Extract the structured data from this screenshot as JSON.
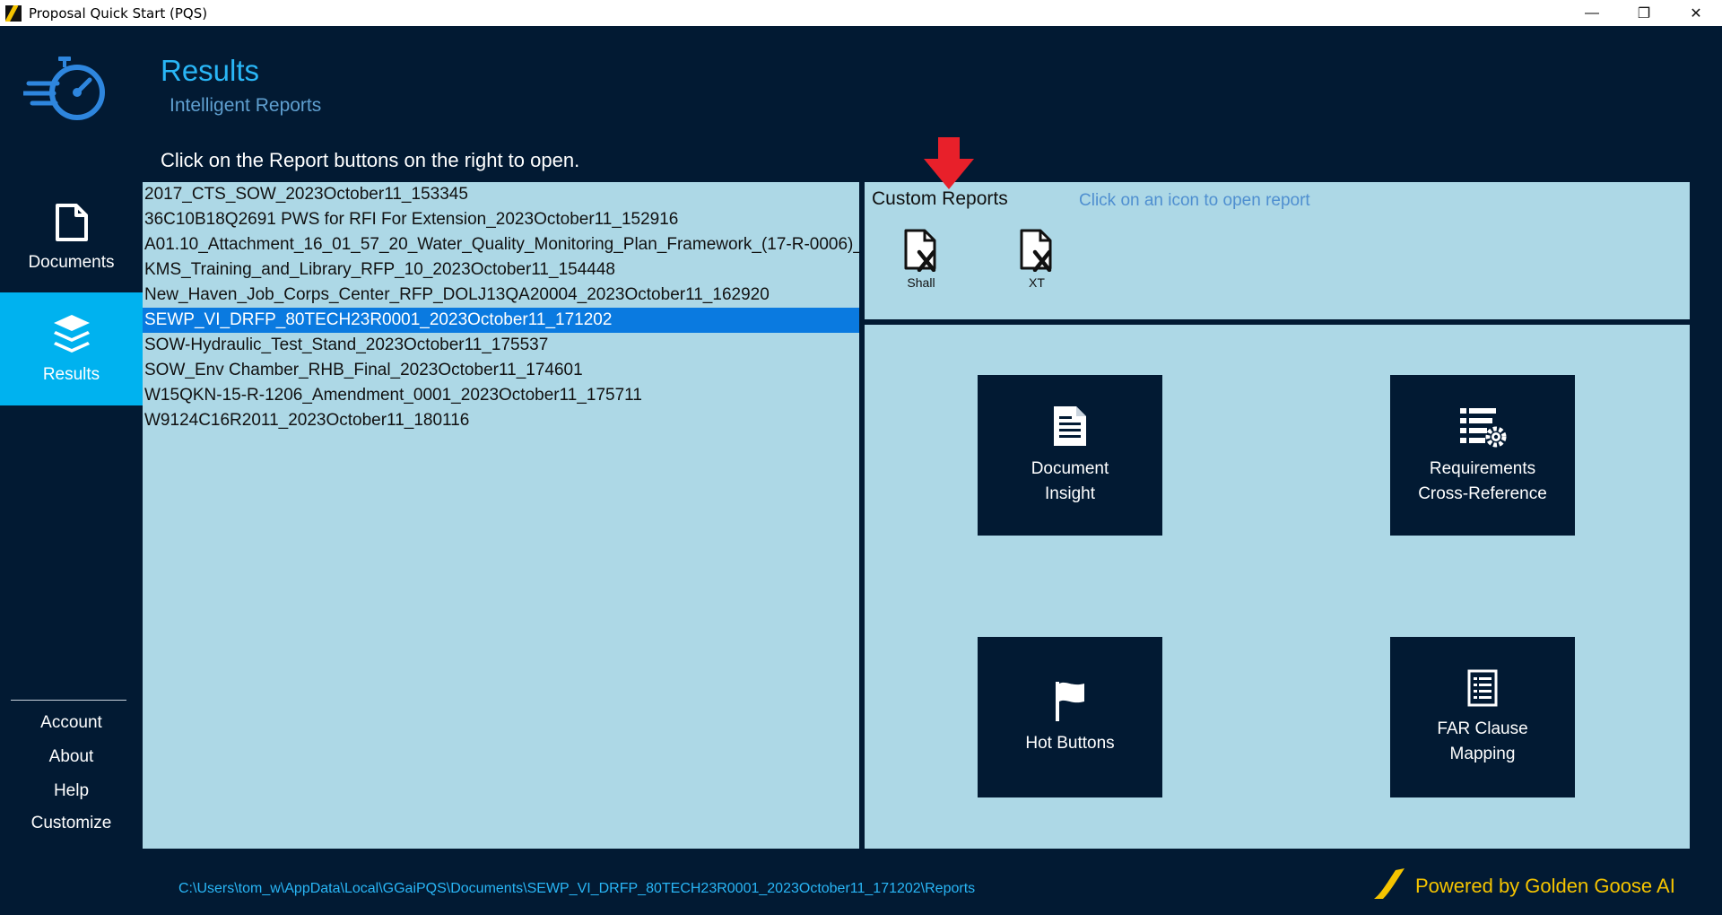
{
  "window": {
    "title": "Proposal Quick Start (PQS)",
    "minimize": "—",
    "restore": "❐",
    "close": "✕"
  },
  "header": {
    "title": "Results",
    "subtitle": "Intelligent Reports",
    "instruction": "Click on the Report buttons on the right to open."
  },
  "sidebar": {
    "nav": [
      {
        "label": "Documents",
        "icon": "document-icon",
        "active": false
      },
      {
        "label": "Results",
        "icon": "layers-icon",
        "active": true
      }
    ],
    "links": [
      "Account",
      "About",
      "Help",
      "Customize"
    ]
  },
  "documents": {
    "items": [
      "2017_CTS_SOW_2023October11_153345",
      "36C10B18Q2691 PWS for RFI For Extension_2023October11_152916",
      "A01.10_Attachment_16_01_57_20_Water_Quality_Monitoring_Plan_Framework_(17-R-0006)_",
      "KMS_Training_and_Library_RFP_10_2023October11_154448",
      "New_Haven_Job_Corps_Center_RFP_DOLJ13QA20004_2023October11_162920",
      "SEWP_VI_DRFP_80TECH23R0001_2023October11_171202",
      "SOW-Hydraulic_Test_Stand_2023October11_175537",
      "SOW_Env Chamber_RHB_Final_2023October11_174601",
      "W15QKN-15-R-1206_Amendment_0001_2023October11_175711",
      "W9124C16R2011_2023October11_180116"
    ],
    "selected_index": 5
  },
  "custom_reports": {
    "title": "Custom Reports",
    "hint": "Click on an icon to open report",
    "buttons": [
      {
        "label": "Shall",
        "icon": "excel-file-icon"
      },
      {
        "label": "XT",
        "icon": "excel-file-icon"
      }
    ]
  },
  "reports": {
    "tiles": [
      {
        "line1": "Document",
        "line2": "Insight",
        "icon": "document-lines-icon"
      },
      {
        "line1": "Requirements",
        "line2": "Cross-Reference",
        "icon": "list-gear-icon"
      },
      {
        "line1": "Hot Buttons",
        "line2": "",
        "icon": "flag-icon"
      },
      {
        "line1": "FAR Clause",
        "line2": "Mapping",
        "icon": "clipboard-list-icon"
      }
    ]
  },
  "footer": {
    "path": "C:\\Users\\tom_w\\AppData\\Local\\GGaiPQS\\Documents\\SEWP_VI_DRFP_80TECH23R0001_2023October11_171202\\Reports",
    "powered_by": "Powered by Golden Goose AI"
  },
  "colors": {
    "background": "#021a33",
    "panel": "#add8e6",
    "accent": "#00b2ef",
    "selected_row": "#0a7ae0",
    "brand_yellow": "#f5c400"
  }
}
